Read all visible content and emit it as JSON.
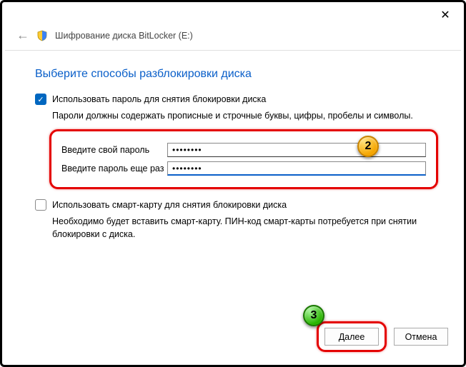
{
  "titlebar": {
    "close": "✕"
  },
  "breadcrumb": {
    "back": "←",
    "text": "Шифрование диска BitLocker (E:)"
  },
  "heading": "Выберите способы разблокировки диска",
  "password": {
    "checkbox_label": "Использовать пароль для снятия блокировки диска",
    "help": "Пароли должны содержать прописные и строчные буквы, цифры, пробелы и символы.",
    "label1": "Введите свой пароль",
    "label2": "Введите пароль еще раз",
    "value1": "••••••••",
    "value2": "••••••••"
  },
  "smartcard": {
    "checkbox_label": "Использовать смарт-карту для снятия блокировки диска",
    "help": "Необходимо будет вставить смарт-карту. ПИН-код смарт-карты потребуется при снятии блокировки с диска."
  },
  "callouts": {
    "c2": "2",
    "c3": "3"
  },
  "buttons": {
    "next": "Далее",
    "cancel": "Отмена"
  }
}
